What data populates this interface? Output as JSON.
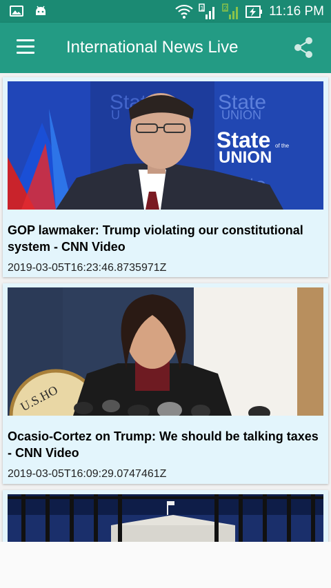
{
  "status_bar": {
    "time": "11:16 PM",
    "left_icons": [
      "image-notification-icon",
      "android-icon"
    ],
    "right_icons": [
      "wifi-icon",
      "signal-icon",
      "signal-icon",
      "battery-charging-icon"
    ]
  },
  "app_bar": {
    "title": "International News Live",
    "menu_icon": "menu-icon",
    "share_icon": "share-icon"
  },
  "articles": [
    {
      "title": "GOP lawmaker: Trump violating our constitutional system - CNN Video",
      "date": "2019-03-05T16:23:46.8735971Z",
      "thumbnail_text": [
        "State",
        "of the",
        "UNION"
      ]
    },
    {
      "title": "Ocasio-Cortez on Trump: We should be talking taxes - CNN Video",
      "date": "2019-03-05T16:09:29.0747461Z",
      "thumbnail_text": [
        "U.S.HO"
      ]
    },
    {
      "title": "",
      "date": "",
      "thumbnail_text": []
    }
  ],
  "colors": {
    "status_bar": "#1b8a73",
    "app_bar": "#239b84",
    "card_bg": "#e3f5fc"
  }
}
